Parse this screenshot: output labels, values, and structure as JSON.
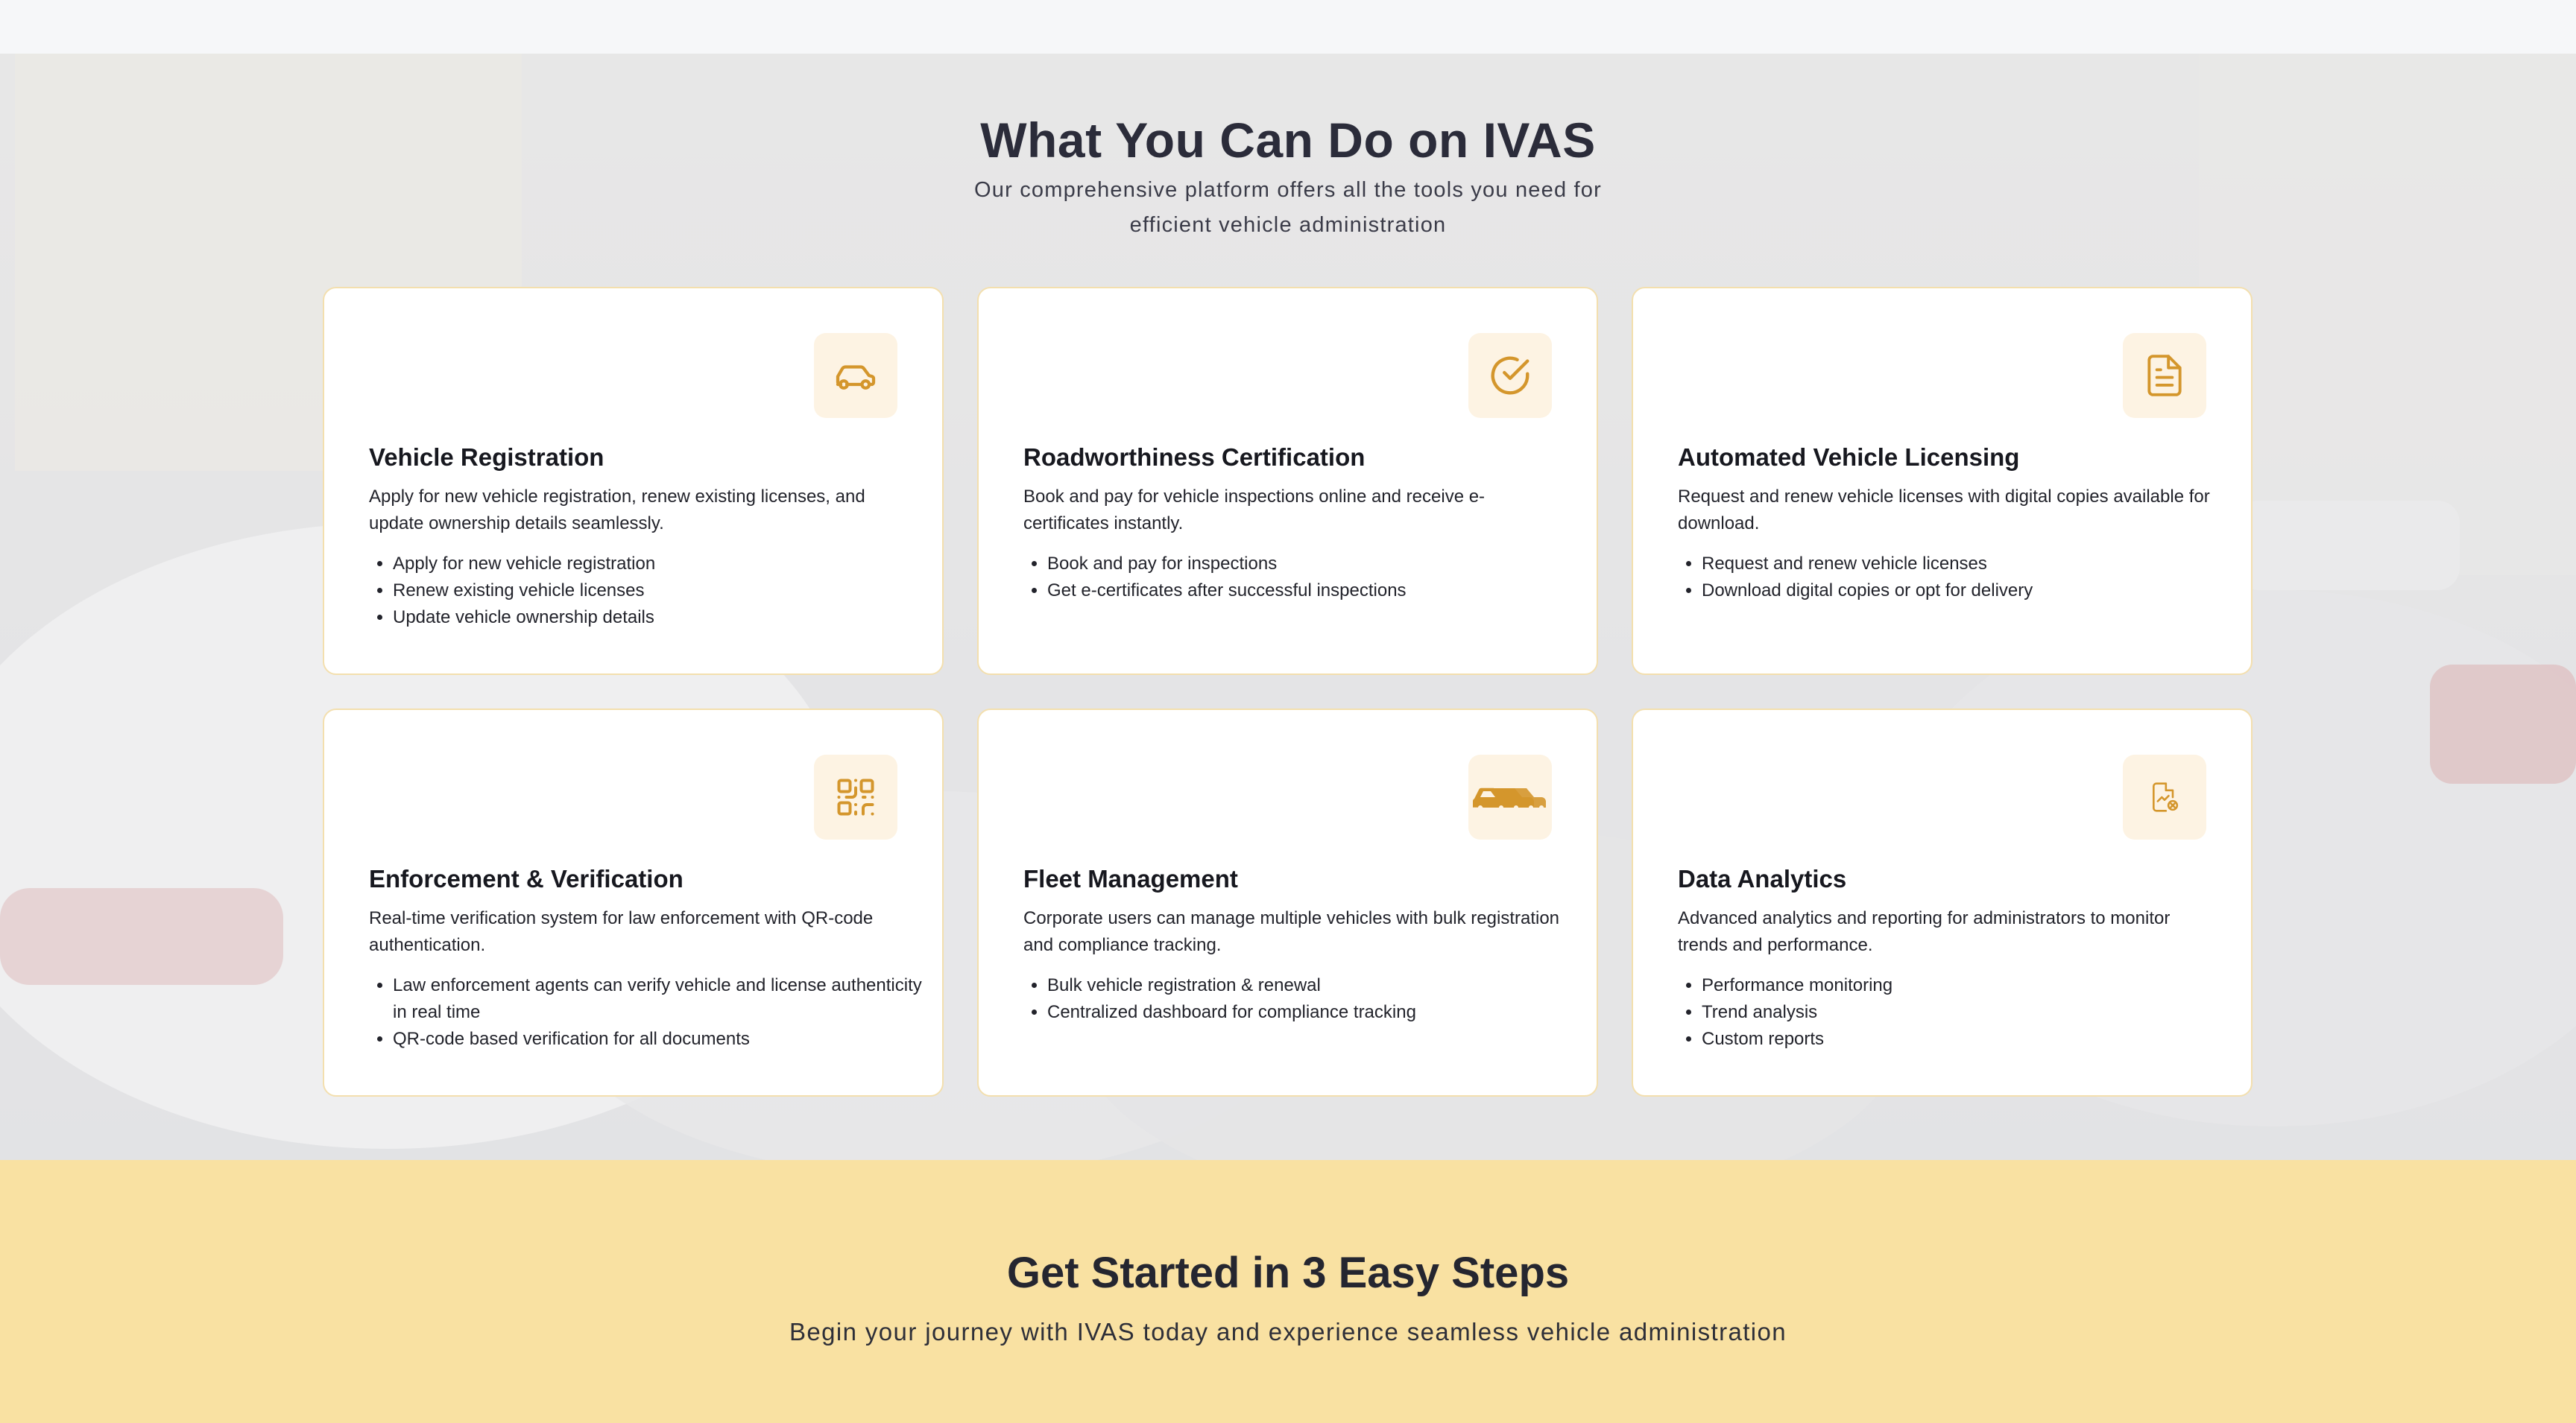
{
  "features": {
    "title": "What You Can Do on IVAS",
    "subtitle": "Our comprehensive platform offers all the tools you need for efficient vehicle administration",
    "cards": [
      {
        "icon": "car-outline-icon",
        "title": "Vehicle Registration",
        "description": "Apply for new vehicle registration, renew existing licenses, and update ownership details seamlessly.",
        "bullets": [
          "Apply for new vehicle registration",
          "Renew existing vehicle licenses",
          "Update vehicle ownership details"
        ]
      },
      {
        "icon": "check-circle-icon",
        "title": "Roadworthiness Certification",
        "description": "Book and pay for vehicle inspections online and receive e-certificates instantly.",
        "bullets": [
          "Book and pay for inspections",
          "Get e-certificates after successful inspections"
        ]
      },
      {
        "icon": "document-icon",
        "title": "Automated Vehicle Licensing",
        "description": "Request and renew vehicle licenses with digital copies available for download.",
        "bullets": [
          "Request and renew vehicle licenses",
          "Download digital copies or opt for delivery"
        ]
      },
      {
        "icon": "qr-code-icon",
        "title": "Enforcement & Verification",
        "description": "Real-time verification system for law enforcement with QR-code authentication.",
        "bullets": [
          "Law enforcement agents can verify vehicle and license authenticity in real time",
          "QR-code based verification for all documents"
        ]
      },
      {
        "icon": "fleet-cars-icon",
        "title": "Fleet Management",
        "description": "Corporate users can manage multiple vehicles with bulk registration and compliance tracking.",
        "bullets": [
          "Bulk vehicle registration & renewal",
          "Centralized dashboard for compliance tracking"
        ]
      },
      {
        "icon": "analytics-report-icon",
        "title": "Data Analytics",
        "description": "Advanced analytics and reporting for administrators to monitor trends and performance.",
        "bullets": [
          "Performance monitoring",
          "Trend analysis",
          "Custom reports"
        ]
      }
    ]
  },
  "steps": {
    "title": "Get Started in 3 Easy Steps",
    "subtitle": "Begin your journey with IVAS today and experience seamless vehicle administration"
  },
  "colors": {
    "accent": "#d4962c",
    "icon_tile": "#fdf3e3",
    "card_border": "#f3dfae",
    "steps_background": "#f9e1a2"
  }
}
